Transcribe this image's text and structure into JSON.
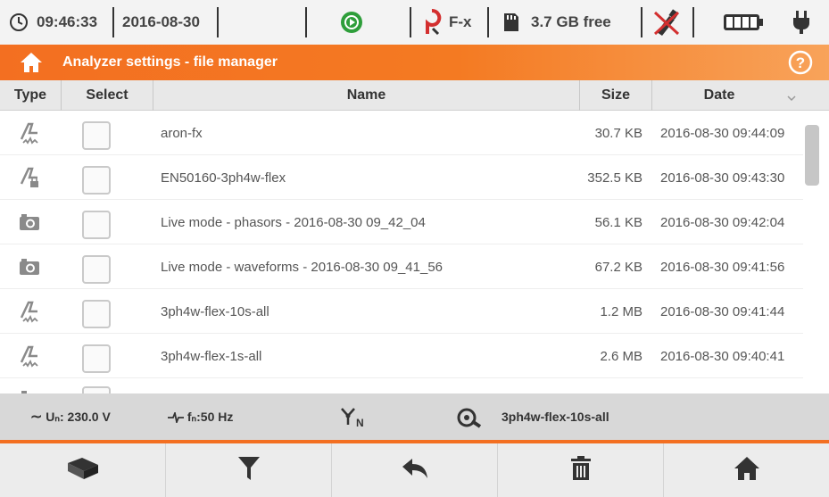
{
  "status": {
    "time": "09:46:33",
    "date": "2016-08-30",
    "clamp_label": "F-x",
    "storage": "3.7 GB free"
  },
  "title": {
    "text": "Analyzer settings - file manager"
  },
  "table": {
    "columns": {
      "type": "Type",
      "select": "Select",
      "name": "Name",
      "size": "Size",
      "date": "Date"
    },
    "rows": [
      {
        "icon": "measurement-settings-icon",
        "name": "aron-fx",
        "size": "30.7 KB",
        "date": "2016-08-30 09:44:09",
        "selected": false
      },
      {
        "icon": "measurement-settings-locked-icon",
        "name": "EN50160-3ph4w-flex",
        "size": "352.5 KB",
        "date": "2016-08-30 09:43:30",
        "selected": false
      },
      {
        "icon": "camera-icon",
        "name": "Live mode - phasors - 2016-08-30 09_42_04",
        "size": "56.1 KB",
        "date": "2016-08-30 09:42:04",
        "selected": false
      },
      {
        "icon": "camera-icon",
        "name": "Live mode - waveforms - 2016-08-30 09_41_56",
        "size": "67.2 KB",
        "date": "2016-08-30 09:41:56",
        "selected": false
      },
      {
        "icon": "measurement-settings-icon",
        "name": "3ph4w-flex-10s-all",
        "size": "1.2 MB",
        "date": "2016-08-30 09:41:44",
        "selected": false
      },
      {
        "icon": "measurement-settings-icon",
        "name": "3ph4w-flex-1s-all",
        "size": "2.6 MB",
        "date": "2016-08-30 09:40:41",
        "selected": false
      }
    ]
  },
  "info": {
    "voltage": "Uₙ: 230.0 V",
    "frequency": "fₙ:50 Hz",
    "config": "3ph4w-flex-10s-all"
  },
  "colors": {
    "accent": "#f36f21",
    "status_green": "#2e9e3a",
    "clamp_red": "#d32f2f"
  }
}
